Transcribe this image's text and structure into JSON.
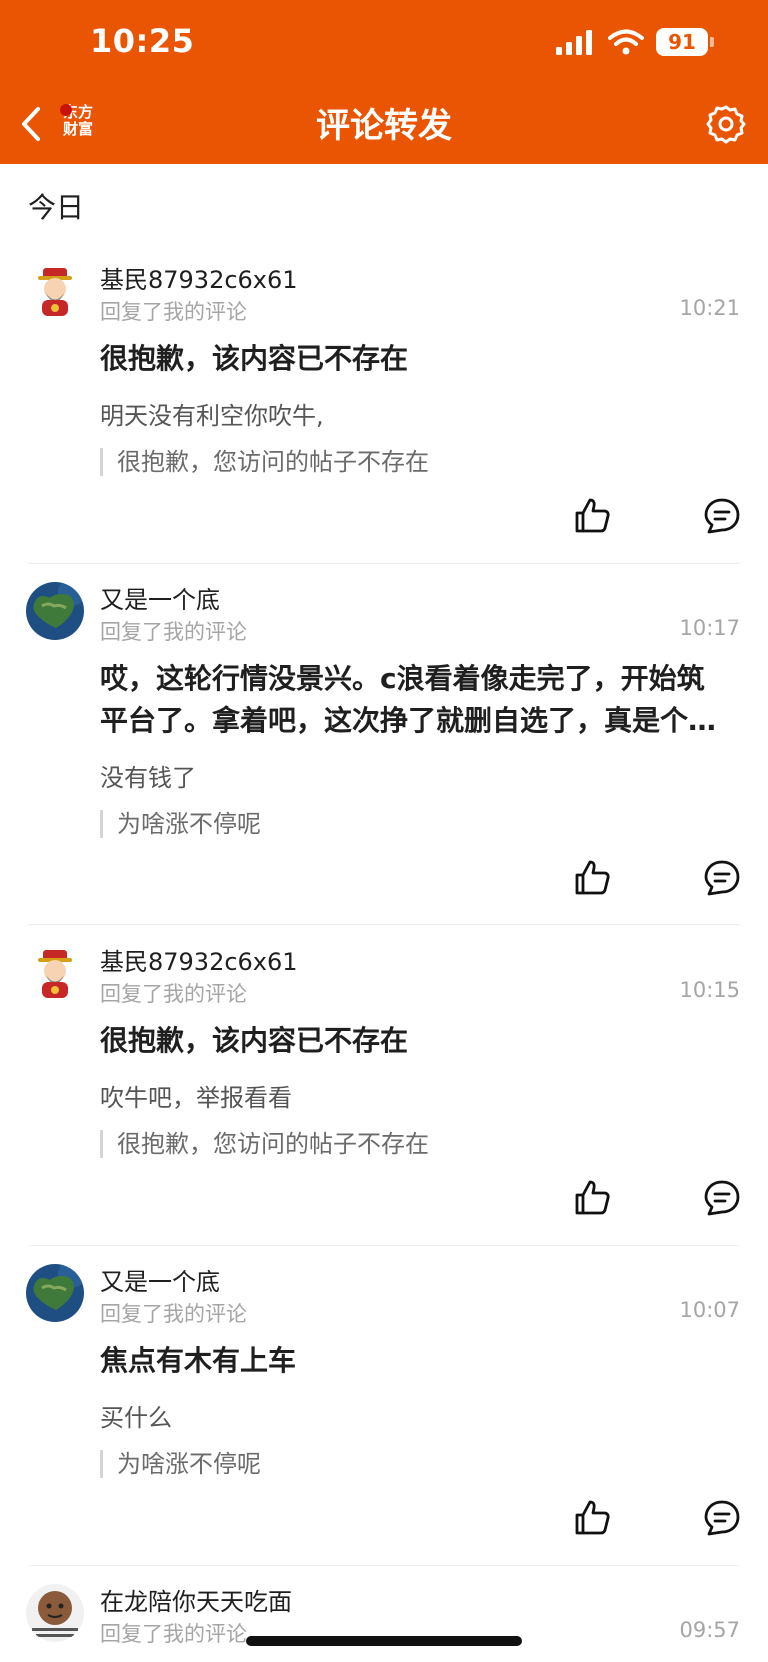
{
  "status_bar": {
    "time": "10:25",
    "battery": "91"
  },
  "header": {
    "title": "评论转发",
    "logo_line1": "东方",
    "logo_line2": "财富"
  },
  "section": {
    "title": "今日"
  },
  "notifications": [
    {
      "username": "基民87932c6x61",
      "action": "回复了我的评论",
      "time": "10:21",
      "content": "很抱歉，该内容已不存在",
      "reply": "明天没有利空你吹牛,",
      "quote": "很抱歉，您访问的帖子不存在"
    },
    {
      "username": "又是一个底",
      "action": "回复了我的评论",
      "time": "10:17",
      "content_line1": "哎，这轮行情没景兴。c浪看着像走完了，开始筑",
      "content_line2": "平台了。拿着吧，这次挣了就删自选了，真是个…",
      "reply": "没有钱了",
      "quote": "为啥涨不停呢"
    },
    {
      "username": "基民87932c6x61",
      "action": "回复了我的评论",
      "time": "10:15",
      "content": "很抱歉，该内容已不存在",
      "reply": "吹牛吧，举报看看",
      "quote": "很抱歉，您访问的帖子不存在"
    },
    {
      "username": "又是一个底",
      "action": "回复了我的评论",
      "time": "10:07",
      "content": "焦点有木有上车",
      "reply": "买什么",
      "quote": "为啥涨不停呢"
    },
    {
      "username": "在龙陪你天天吃面",
      "action": "回复了我的评论",
      "time": "09:57"
    }
  ],
  "icons": {
    "back": "chevron-left-icon",
    "settings": "gear-icon",
    "like": "thumbs-up-icon",
    "comment": "comment-bubble-icon"
  },
  "colors": {
    "brand": "#ea5504",
    "secondary_text": "#a5a5a5"
  }
}
